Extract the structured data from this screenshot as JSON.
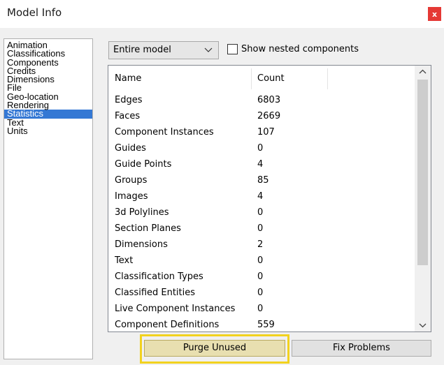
{
  "window": {
    "title": "Model Info",
    "close_label": "x"
  },
  "sidebar": {
    "items": [
      {
        "label": "Animation"
      },
      {
        "label": "Classifications"
      },
      {
        "label": "Components"
      },
      {
        "label": "Credits"
      },
      {
        "label": "Dimensions"
      },
      {
        "label": "File"
      },
      {
        "label": "Geo-location"
      },
      {
        "label": "Rendering"
      },
      {
        "label": "Statistics",
        "selected": true
      },
      {
        "label": "Text"
      },
      {
        "label": "Units"
      }
    ]
  },
  "controls": {
    "scope_select": "Entire model",
    "nested_checkbox_label": "Show nested components",
    "nested_checked": false
  },
  "table": {
    "headers": {
      "name": "Name",
      "count": "Count"
    },
    "rows": [
      {
        "name": "Edges",
        "count": "6803"
      },
      {
        "name": "Faces",
        "count": "2669"
      },
      {
        "name": "Component Instances",
        "count": "107"
      },
      {
        "name": "Guides",
        "count": "0"
      },
      {
        "name": "Guide Points",
        "count": "4"
      },
      {
        "name": "Groups",
        "count": "85"
      },
      {
        "name": "Images",
        "count": "4"
      },
      {
        "name": "3d Polylines",
        "count": "0"
      },
      {
        "name": "Section Planes",
        "count": "0"
      },
      {
        "name": "Dimensions",
        "count": "2"
      },
      {
        "name": "Text",
        "count": "0"
      },
      {
        "name": "Classification Types",
        "count": "0"
      },
      {
        "name": "Classified Entities",
        "count": "0"
      },
      {
        "name": "Live Component Instances",
        "count": "0"
      },
      {
        "name": "Component Definitions",
        "count": "559"
      }
    ]
  },
  "buttons": {
    "purge": "Purge Unused",
    "fix": "Fix Problems"
  },
  "colors": {
    "selection": "#3478d4",
    "close": "#e53935",
    "highlight": "#f2d21f"
  },
  "icons": {
    "dropdown": "chevron-down-icon",
    "scroll_up": "scroll-up-icon",
    "scroll_down": "scroll-down-icon",
    "close": "close-icon"
  }
}
